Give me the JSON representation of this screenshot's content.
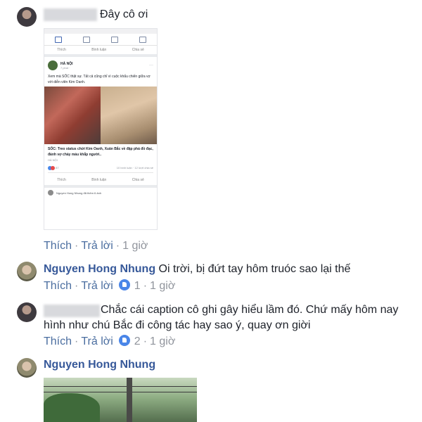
{
  "comments": [
    {
      "author": "",
      "text": "Đây cô ơi",
      "actions": {
        "like": "Thích",
        "reply": "Trả lời",
        "time": "1 giờ"
      },
      "attachment": {
        "post": {
          "page_name": "HÀ NỘI",
          "subtitle": "7 phút · ",
          "text": "Xem mà SỐC thật sự. Tất cả cũng chỉ vì cuộc khẩu chiến giữa vợ với diễn viên Kim Oanh.",
          "link_title": "SỐC: Treo status chửi Kim Oanh, Xuân Bắc về đập phá đồ đạc, đánh vợ chảy máu khắp người..",
          "link_source": "HÀ NỘI",
          "reactions": "87",
          "stats": "10 bình luận · 12 lượt chia sẻ",
          "buttons": [
            "Thích",
            "Bình luận",
            "Chia sẻ"
          ],
          "top_buttons": [
            "Thích",
            "Bình luận",
            "Chia sẻ"
          ],
          "next_post": "Nguyen Hong Nhung đã thêm 6 ảnh"
        }
      }
    },
    {
      "author": "Nguyen Hong Nhung",
      "text": "Oi trời, bị đứt tay hôm truóc sao lại thế",
      "actions": {
        "like": "Thích",
        "reply": "Trả lời",
        "likes": "1",
        "time": "1 giờ"
      }
    },
    {
      "author": "",
      "text_line1": "Chắc cái caption cô ghi gây hiểu lầm đó. Chứ mấy hôm nay",
      "text_line2": "hình như chú Bắc đi công tác hay sao ý, quay ơn giời",
      "actions": {
        "like": "Thích",
        "reply": "Trả lời",
        "likes": "2",
        "time": "1 giờ"
      }
    },
    {
      "author": "Nguyen Hong Nhung",
      "attachment": "photo"
    }
  ],
  "colors": {
    "link": "#4b6ea0",
    "author": "#365899",
    "like_badge": "#4a86e8",
    "muted": "#90949c"
  }
}
